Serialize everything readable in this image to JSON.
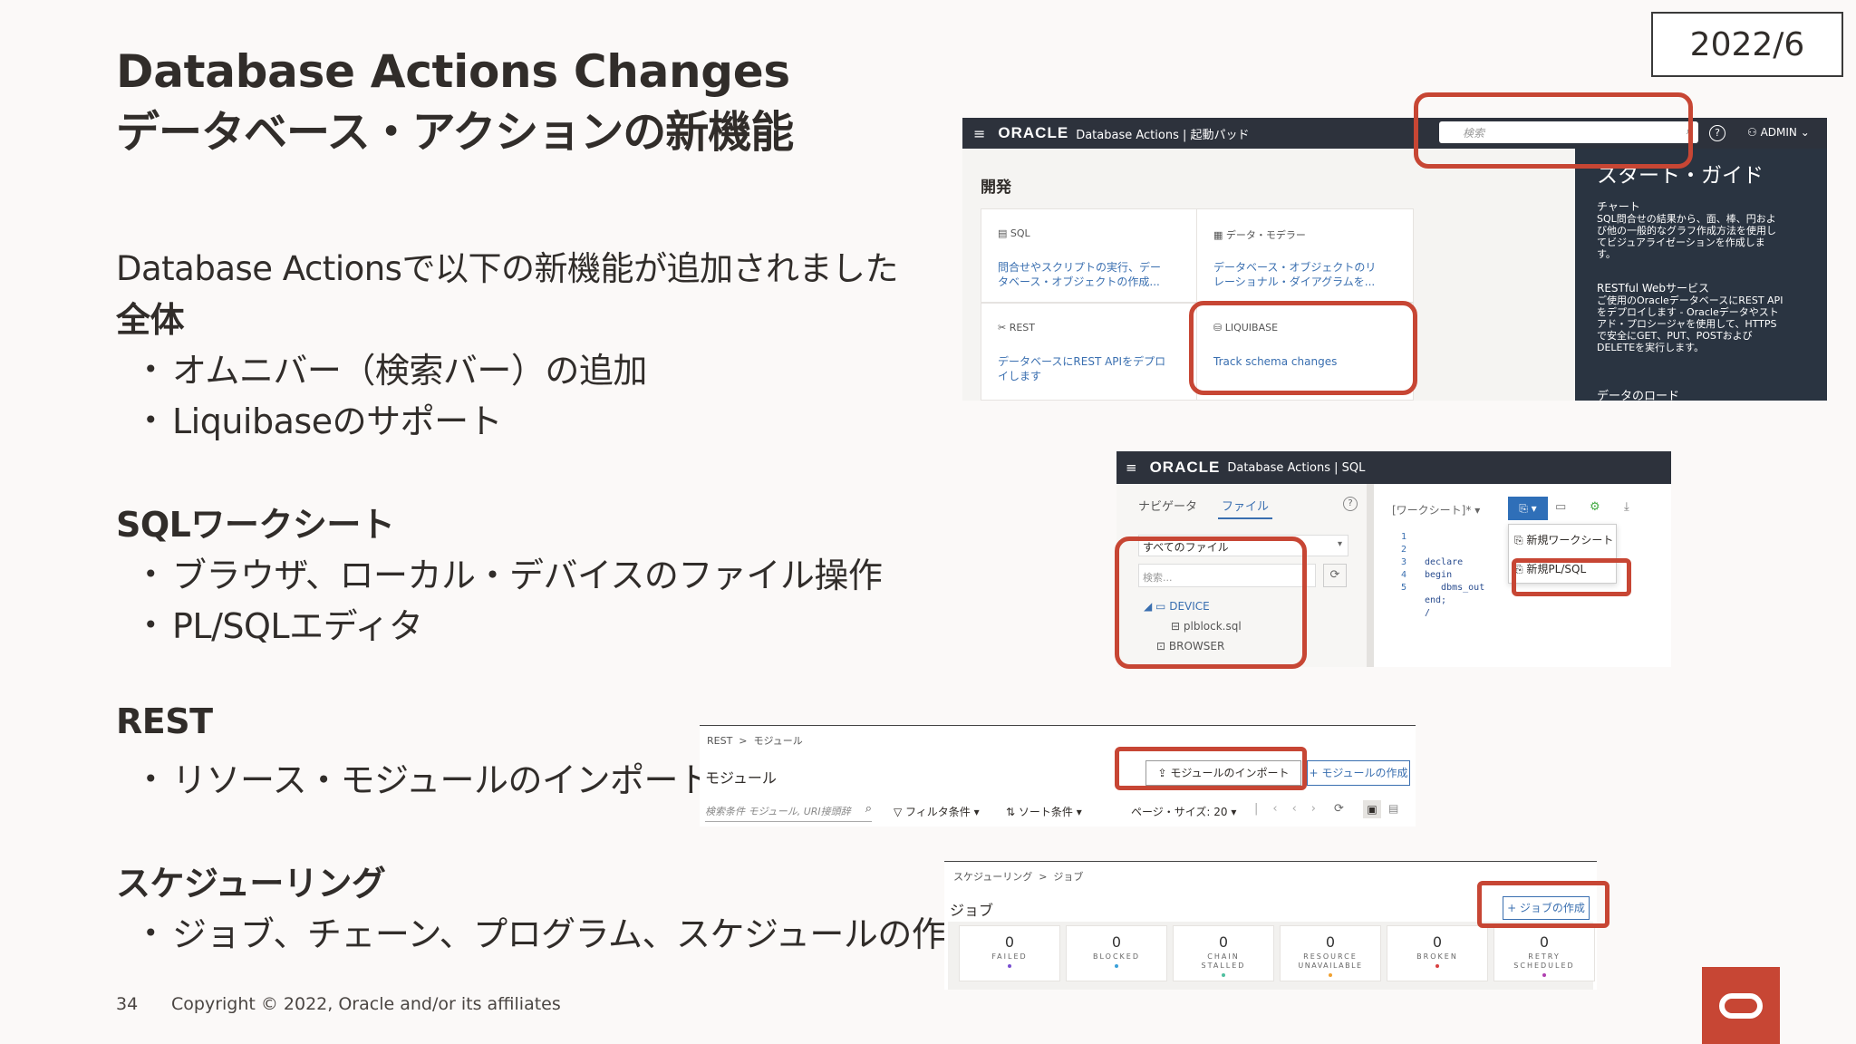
{
  "slide": {
    "title_en": "Database Actions Changes",
    "title_ja": "データベース・アクションの新機能",
    "date": "2022/6",
    "intro": "Database Actionsで以下の新機能が追加されました",
    "sections": [
      {
        "heading": "全体",
        "bullets": [
          "オムニバー（検索バー）の追加",
          "Liquibaseのサポート"
        ]
      },
      {
        "heading": "SQLワークシート",
        "bullets": [
          "ブラウザ、ローカル・デバイスのファイル操作",
          "PL/SQLエディタ"
        ]
      },
      {
        "heading": "REST",
        "bullets": [
          "リソース・モジュールのインポート"
        ]
      },
      {
        "heading": "スケジューリング",
        "bullets": [
          "ジョブ、チェーン、プログラム、スケジュールの作成"
        ]
      }
    ],
    "page_number": "34",
    "copyright": "Copyright © 2022, Oracle and/or its affiliates"
  },
  "shot1": {
    "brand": "ORACLE",
    "app_title": "Database Actions | 起動パッド",
    "search_placeholder": "検索",
    "user": "ADMIN",
    "section": "開発",
    "cards": [
      {
        "title": "SQL",
        "desc1": "問合せやスクリプトの実行、デー",
        "desc2": "タベース・オブジェクトの作成..."
      },
      {
        "title": "データ・モデラー",
        "desc1": "データベース・オブジェクトのリ",
        "desc2": "レーショナル・ダイアグラムを..."
      },
      {
        "title": "REST",
        "desc1": "データベースにREST APIをデプロ",
        "desc2": "イします"
      },
      {
        "title": "LIQUIBASE",
        "desc1": "Track schema changes",
        "desc2": ""
      }
    ],
    "side_title": "スタート・ガイド",
    "side_chart_head": "チャート",
    "side_chart_lines": [
      "SQL問合せの結果から、面、棒、円およ",
      "び他の一般的なグラフ作成方法を使用し",
      "てビジュアライゼーションを作成しま",
      "す。"
    ],
    "side_rest_head": "RESTful Webサービス",
    "side_rest_lines": [
      "ご使用のOracleデータベースにREST API",
      "をデプロイします - Oracleデータやスト",
      "アド・プロシージャを使用して、HTTPS",
      "で安全にGET、PUT、POSTおよび",
      "DELETEを実行します。"
    ],
    "side_load_head": "データのロード"
  },
  "shot2": {
    "brand": "ORACLE",
    "app_title": "Database Actions | SQL",
    "tab_navigator": "ナビゲータ",
    "tab_file": "ファイル",
    "file_select": "すべてのファイル",
    "search_placeholder": "検索...",
    "tree_device": "DEVICE",
    "tree_file": "plblock.sql",
    "tree_browser": "BROWSER",
    "worksheet_tab": "[ワークシート]*",
    "code_lines": [
      "declare",
      "begin",
      "   dbms_out",
      "end;",
      "/"
    ],
    "line_numbers": [
      "1",
      "2",
      "3",
      "4",
      "5"
    ],
    "menu_new_worksheet": "新規ワークシート",
    "menu_new_plsql": "新規PL/SQL"
  },
  "shot3": {
    "breadcrumb": "REST  >  モジュール",
    "heading": "モジュール",
    "import_button": "モジュールのインポート",
    "create_button": "+ モジュールの作成",
    "search_placeholder": "検索条件 モジュール, URI接頭辞",
    "filter": "フィルタ条件",
    "sort": "ソート条件",
    "page_size": "ページ・サイズ: 20"
  },
  "shot4": {
    "breadcrumb": "スケジューリング  >  ジョブ",
    "heading": "ジョブ",
    "create_button": "+ ジョブの作成",
    "stats": [
      {
        "value": "0",
        "label1": "FAILED",
        "label2": "",
        "color": "#7a4fd0"
      },
      {
        "value": "0",
        "label1": "BLOCKED",
        "label2": "",
        "color": "#3aa0d8"
      },
      {
        "value": "0",
        "label1": "CHAIN",
        "label2": "STALLED",
        "color": "#4fbf9f"
      },
      {
        "value": "0",
        "label1": "RESOURCE",
        "label2": "UNAVAILABLE",
        "color": "#f0a030"
      },
      {
        "value": "0",
        "label1": "BROKEN",
        "label2": "",
        "color": "#d84040"
      },
      {
        "value": "0",
        "label1": "RETRY",
        "label2": "SCHEDULED",
        "color": "#b040b0"
      }
    ]
  },
  "colors": {
    "accent": "#c74634",
    "topbar": "#2d323c",
    "link": "#3a6fb0"
  }
}
